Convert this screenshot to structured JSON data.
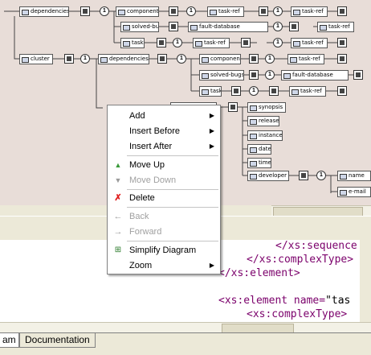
{
  "diagram": {
    "nodes": {
      "dependencies1": "dependencies",
      "components1": "components",
      "taskref1": "task-ref",
      "taskref2": "task-ref",
      "solved1": "solved-bugs",
      "faultdb1": "fault-database",
      "taskref3": "task-ref",
      "tasks1": "tasks",
      "taskref4": "task-ref",
      "taskref5": "task-ref",
      "cluster": "cluster",
      "dependencies2": "dependencies",
      "components2": "components",
      "taskref6": "task-ref",
      "solved2": "solved-bugs",
      "faultdb2": "fault-database",
      "tasks2": "tasks",
      "taskref7": "task-ref",
      "synopsis": "synopsis",
      "release": "release",
      "instance": "instance",
      "date": "date",
      "time": "time",
      "developer": "developer",
      "name": "name",
      "email": "e-mail"
    }
  },
  "context_menu": {
    "add": "Add",
    "insert_before": "Insert Before",
    "insert_after": "Insert After",
    "move_up": "Move Up",
    "move_down": "Move Down",
    "delete": "Delete",
    "back": "Back",
    "forward": "Forward",
    "simplify": "Simplify Diagram",
    "zoom": "Zoom"
  },
  "editor": {
    "line1": "</xs:sequence",
    "line2": "</xs:complexType>",
    "line3": "</xs:element>",
    "line4_tag": "<xs:element",
    "line4_attr": "name=",
    "line4_val": "\"tas",
    "line5": "<xs:complexType>"
  },
  "tabs": {
    "diagram": "am",
    "documentation": "Documentation"
  }
}
